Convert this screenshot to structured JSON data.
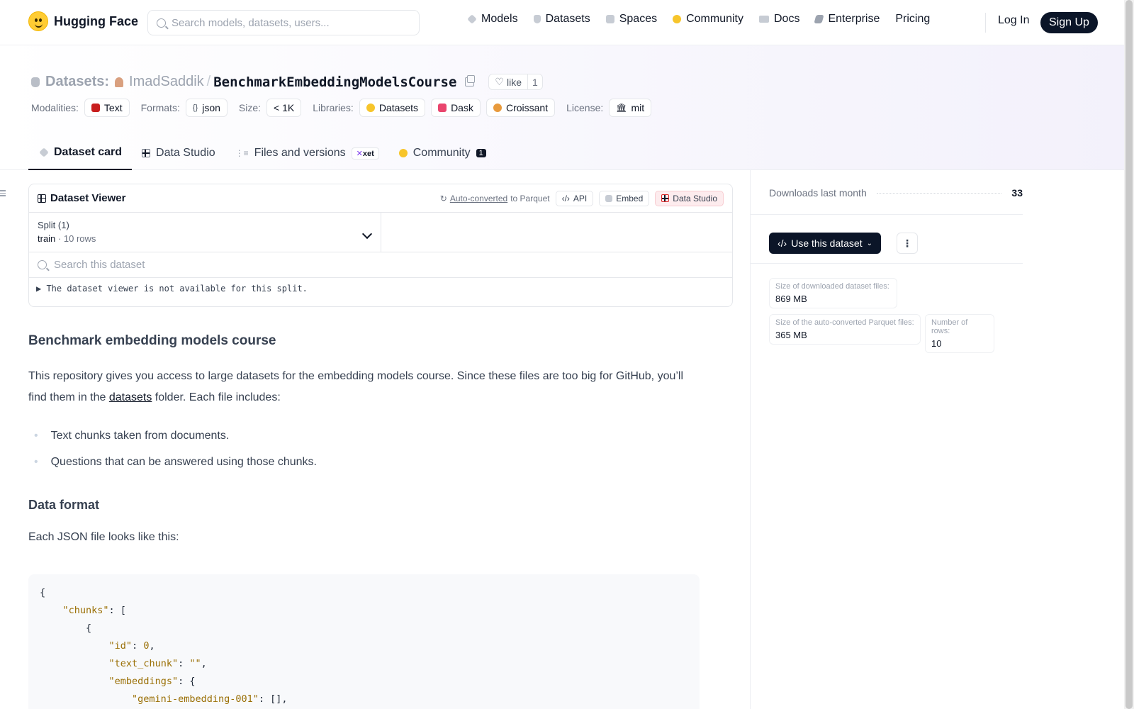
{
  "nav": {
    "brand": "Hugging Face",
    "search_placeholder": "Search models, datasets, users...",
    "links": [
      "Models",
      "Datasets",
      "Spaces",
      "Community",
      "Docs",
      "Enterprise",
      "Pricing"
    ],
    "login": "Log In",
    "signup": "Sign Up"
  },
  "repo": {
    "section": "Datasets:",
    "owner": "ImadSaddik",
    "separator": "/",
    "name": "BenchmarkEmbeddingModelsCourse",
    "like_label": "like",
    "like_count": "1"
  },
  "meta": {
    "modalities_label": "Modalities:",
    "modality": "Text",
    "formats_label": "Formats:",
    "format": "json",
    "size_label": "Size:",
    "size": "< 1K",
    "libraries_label": "Libraries:",
    "libraries": [
      "Datasets",
      "Dask",
      "Croissant"
    ],
    "license_label": "License:",
    "license": "mit"
  },
  "tabs": {
    "card": "Dataset card",
    "studio": "Data Studio",
    "files": "Files and versions",
    "xet": "xet",
    "community": "Community",
    "community_count": "1"
  },
  "viewer": {
    "title": "Dataset Viewer",
    "autoconverted": "Auto-converted",
    "to_parquet": "to Parquet",
    "api": "API",
    "embed": "Embed",
    "data_studio": "Data Studio",
    "split_label": "Split (1)",
    "split_value": "train",
    "split_dot": "·",
    "split_rows": "10 rows",
    "search_placeholder": "Search this dataset",
    "unavailable": "▶ The dataset viewer is not available for this split."
  },
  "card": {
    "heading": "Benchmark embedding models course",
    "intro_1": "This repository gives you access to large datasets for the embedding models course. Since these files are too big for GitHub, you’ll find them in the ",
    "intro_link": "datasets",
    "intro_2": " folder. Each file includes:",
    "bullets": [
      "Text chunks taken from documents.",
      "Questions that can be answered using those chunks."
    ],
    "format_heading": "Data format",
    "format_intro": "Each JSON file looks like this:",
    "code": {
      "l1": "{",
      "l2_key": "\"chunks\"",
      "l2_rest": ": [",
      "l3": "{",
      "l4_key": "\"id\"",
      "l4_sep": ": ",
      "l4_val": "0",
      "l4_end": ",",
      "l5_key": "\"text_chunk\"",
      "l5_sep": ": ",
      "l5_val": "\"\"",
      "l5_end": ",",
      "l6_key": "\"embeddings\"",
      "l6_rest": ": {",
      "l7_key": "\"gemini-embedding-001\"",
      "l7_rest": ": [],"
    }
  },
  "sidebar": {
    "downloads_label": "Downloads last month",
    "downloads_value": "33",
    "use_button": "Use this dataset",
    "more": "⋮",
    "stats": [
      {
        "label": "Size of downloaded dataset files:",
        "value": "869 MB"
      },
      {
        "label": "Size of the auto-converted Parquet files:",
        "value": "365 MB"
      },
      {
        "label": "Number of rows:",
        "value": "10"
      }
    ]
  }
}
